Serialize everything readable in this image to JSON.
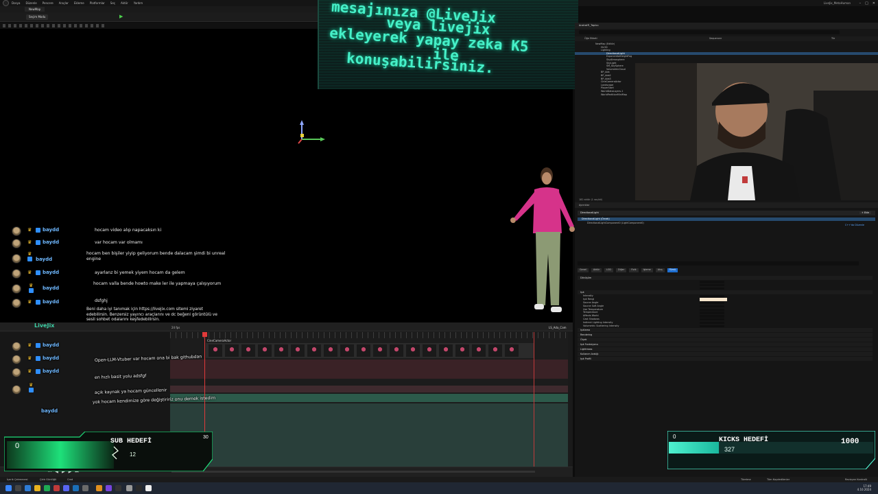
{
  "titlebar": {
    "menu": [
      "Dosya",
      "Düzenle",
      "Pencere",
      "Araçlar",
      "Ekleme",
      "Platformlar",
      "Seç",
      "Aktör",
      "Yardım"
    ],
    "project": "LiveJix_MetaHuman"
  },
  "editor": {
    "map_tab": "NewMap",
    "mode_label": "Seçim Modu"
  },
  "banner": {
    "line1": "mesajınıza @LiveJix",
    "line2": "veya livejix",
    "line3": "ekleyerek yapay zeka K5",
    "line4": "ile",
    "line5": "konuşabilirsiniz."
  },
  "outliner": {
    "title": "Anahat®_Taşıtıcı",
    "col_label": "Öğe Etiketi",
    "col_type": "Tür",
    "col_extra": "Sequencer",
    "rows": [
      "NewMap (Editör)",
      "HLOD",
      "Lighting",
      "DirectionalLight",
      "ExponentialHeightFog",
      "SkyAtmosphere",
      "SkyLight",
      "SM_SkySphere",
      "VolumetricCloud",
      "BP_Ada",
      "BP_Ada2",
      "BP_Ada3",
      "CineCameraActor",
      "Landscape",
      "PlayerStart",
      "WorldDataLayers-1",
      "WorldPartitionMiniMap"
    ],
    "selected_index": 3,
    "footer": "182 aktör (1 seçildi)"
  },
  "details": {
    "title": "Ayrıntılar",
    "actor_name": "DirectionalLight",
    "add_label": "+ Ekle",
    "component_root": "DirectionalLight (Örnek)",
    "component_child": "DirectionalLightComponent0 (LightComponent0)",
    "edit_label": "C++'da Düzenle",
    "filters": [
      "Genel",
      "Aktör",
      "LOD",
      "Diğer",
      "Fizik",
      "Işleme",
      "Akış",
      "Tümü"
    ],
    "active_filter_index": 7,
    "sections": [
      "Dönüşüm",
      "Işık",
      "Işıklama",
      "Rendering",
      "Ölçek",
      "Işık Fonksiyonu",
      "Lightmass",
      "Kullanım Aralığı",
      "Işık Profili"
    ],
    "light_props": [
      "Intensity",
      "Işık Rengi",
      "Source Angle",
      "Source Soft Angle",
      "Use Temperature",
      "Temperature",
      "Affects World",
      "Cast Shadows",
      "Indirect Lighting Intensity",
      "Volumetric Scattering Intensity"
    ]
  },
  "sequencer": {
    "brand": "LiveJix",
    "fps": "24 fps",
    "shot": "LS_Ada_Cam",
    "track_header": "CineCameraActor"
  },
  "chat": [
    {
      "user": "baydd",
      "text": "hocam video alıp napacaksın ki"
    },
    {
      "user": "baydd",
      "text": "var hocam var olmamı"
    },
    {
      "user": "baydd",
      "text": "hocam ben bişiler yiyip geliyorum bende dalacam şimdi bi unreal engine"
    },
    {
      "user": "baydd",
      "text": "ayarlanz bi yemek yiyem hocam da gelem"
    },
    {
      "user": "baydd",
      "text": "hocam valla bende howto make ler ile yapmaya çalışıyorum"
    },
    {
      "user": "baydd",
      "text": "dsfghj"
    },
    {
      "user": "",
      "text": "Beni daha iyi tanımak için https://livejix.com sitemi ziyaret edebilirsin. Benzersiz yayıncı araçlarını ve dc beğeni görüntülü ve sesli sohbet odalarını keşfedebilirsin."
    },
    {
      "user": "baydd",
      "text": "Open-LLM-Vtuber var hocam ona bi bak githubdan"
    },
    {
      "user": "baydd",
      "text": "en hızlı basit yolu adsfgf"
    },
    {
      "user": "baydd",
      "text": "açık kaynak ya hocam güncellenir"
    },
    {
      "user": "baydd",
      "text": "yok hocam kendimize göre değiştiririz onu demek istedim"
    }
  ],
  "sub_goal": {
    "title": "SUB HEDEFİ",
    "current": "0",
    "target": "30",
    "secondary": "12",
    "progress_fraction": 0.0
  },
  "kick_goal": {
    "title": "KICKS HEDEFİ",
    "current": "0",
    "value": "327",
    "target": "1000",
    "progress_fraction": 0.327
  },
  "statusbar": {
    "left1": "İçerik Çekmecesi",
    "left2": "Çıktı Günlüğü",
    "left3": "Cmd",
    "right1": "Türetme",
    "right2": "Tüm Kaydedilenler",
    "right3": "Revizyon Kontrolü"
  },
  "taskbar": {
    "time": "17:49",
    "date": "4.10.2024"
  },
  "colors": {
    "accent_green": "#46f0c8",
    "ue_select_blue": "#264a6e",
    "goal_green": "#1ee07a"
  }
}
